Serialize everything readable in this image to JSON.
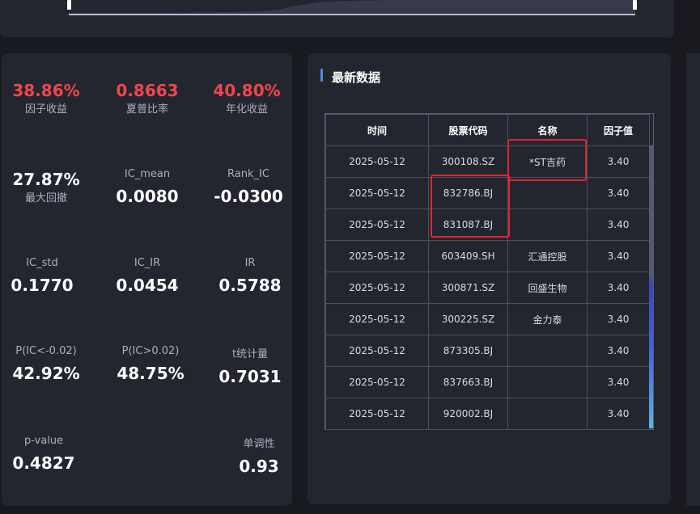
{
  "metrics": {
    "factor_return": {
      "value": "38.86%",
      "label": "因子收益"
    },
    "sharpe": {
      "value": "0.8663",
      "label": "夏普比率"
    },
    "annual_return": {
      "value": "40.80%",
      "label": "年化收益"
    },
    "max_drawdown": {
      "value": "27.87%",
      "label": "最大回撤"
    },
    "ic_mean": {
      "value": "0.0080",
      "label": "IC_mean"
    },
    "rank_ic": {
      "value": "-0.0300",
      "label": "Rank_IC"
    },
    "ic_std": {
      "value": "0.1770",
      "label": "IC_std"
    },
    "ic_ir": {
      "value": "0.0454",
      "label": "IC_IR"
    },
    "ir": {
      "value": "0.5788",
      "label": "IR"
    },
    "p_ic_neg": {
      "value": "42.92%",
      "label": "P(IC<-0.02)"
    },
    "p_ic_pos": {
      "value": "48.75%",
      "label": "P(IC>0.02)"
    },
    "t_stat": {
      "value": "0.7031",
      "label": "t统计量"
    },
    "p_value": {
      "value": "0.4827",
      "label": "p-value"
    },
    "monotonicity": {
      "value": "0.93",
      "label": "单调性"
    }
  },
  "latest": {
    "title": "最新数据",
    "headers": [
      "时间",
      "股票代码",
      "名称",
      "因子值"
    ],
    "rows": [
      [
        "2025-05-12",
        "300108.SZ",
        "*ST吉药",
        "3.40"
      ],
      [
        "2025-05-12",
        "832786.BJ",
        "",
        "3.40"
      ],
      [
        "2025-05-12",
        "831087.BJ",
        "",
        "3.40"
      ],
      [
        "2025-05-12",
        "603409.SH",
        "汇通控股",
        "3.40"
      ],
      [
        "2025-05-12",
        "300871.SZ",
        "回盛生物",
        "3.40"
      ],
      [
        "2025-05-12",
        "300225.SZ",
        "金力泰",
        "3.40"
      ],
      [
        "2025-05-12",
        "873305.BJ",
        "",
        "3.40"
      ],
      [
        "2025-05-12",
        "837663.BJ",
        "",
        "3.40"
      ],
      [
        "2025-05-12",
        "920002.BJ",
        "",
        "3.40"
      ]
    ]
  },
  "colors": {
    "accent_red": "#f0474d",
    "highlight": "#e0262b",
    "panel": "#23262f"
  }
}
